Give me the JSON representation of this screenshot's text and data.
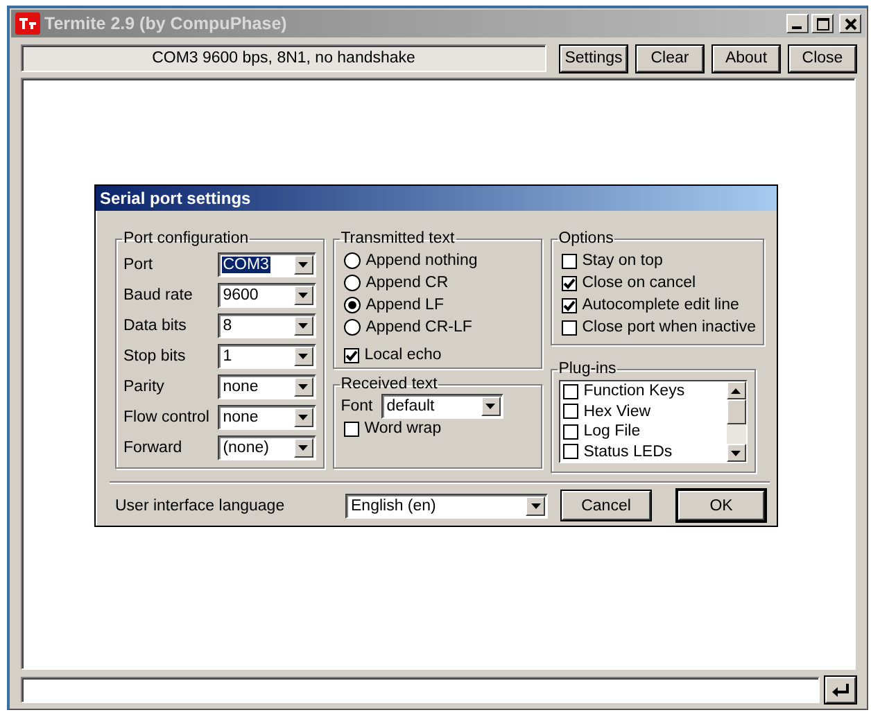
{
  "window": {
    "title": "Termite 2.9 (by CompuPhase)"
  },
  "toolbar": {
    "status": "COM3 9600 bps, 8N1, no handshake",
    "buttons": [
      "Settings",
      "Clear",
      "About",
      "Close"
    ]
  },
  "dialog": {
    "title": "Serial port settings",
    "port_configuration": {
      "title": "Port configuration",
      "fields": [
        {
          "label": "Port",
          "value": "COM3",
          "highlighted": true
        },
        {
          "label": "Baud rate",
          "value": "9600",
          "highlighted": false
        },
        {
          "label": "Data bits",
          "value": "8",
          "highlighted": false
        },
        {
          "label": "Stop bits",
          "value": "1",
          "highlighted": false
        },
        {
          "label": "Parity",
          "value": "none",
          "highlighted": false
        },
        {
          "label": "Flow control",
          "value": "none",
          "highlighted": false
        },
        {
          "label": "Forward",
          "value": "(none)",
          "highlighted": false
        }
      ]
    },
    "transmitted_text": {
      "title": "Transmitted text",
      "options": [
        {
          "label": "Append nothing",
          "selected": false
        },
        {
          "label": "Append CR",
          "selected": false
        },
        {
          "label": "Append LF",
          "selected": true
        },
        {
          "label": "Append CR-LF",
          "selected": false
        }
      ],
      "local_echo": {
        "label": "Local echo",
        "checked": true
      }
    },
    "received_text": {
      "title": "Received text",
      "font": {
        "label": "Font",
        "value": "default"
      },
      "word_wrap": {
        "label": "Word wrap",
        "checked": false
      }
    },
    "options": {
      "title": "Options",
      "items": [
        {
          "label": "Stay on top",
          "checked": false
        },
        {
          "label": "Close on cancel",
          "checked": true
        },
        {
          "label": "Autocomplete edit line",
          "checked": true
        },
        {
          "label": "Close port when inactive",
          "checked": false
        }
      ]
    },
    "plugins": {
      "title": "Plug-ins",
      "items": [
        {
          "label": "Function Keys",
          "checked": false
        },
        {
          "label": "Hex View",
          "checked": false
        },
        {
          "label": "Log File",
          "checked": false
        },
        {
          "label": "Status LEDs",
          "checked": false
        }
      ]
    },
    "language": {
      "label": "User interface language",
      "value": "English (en)"
    },
    "buttons": [
      {
        "label": "Cancel",
        "default": false
      },
      {
        "label": "OK",
        "default": true
      }
    ]
  }
}
